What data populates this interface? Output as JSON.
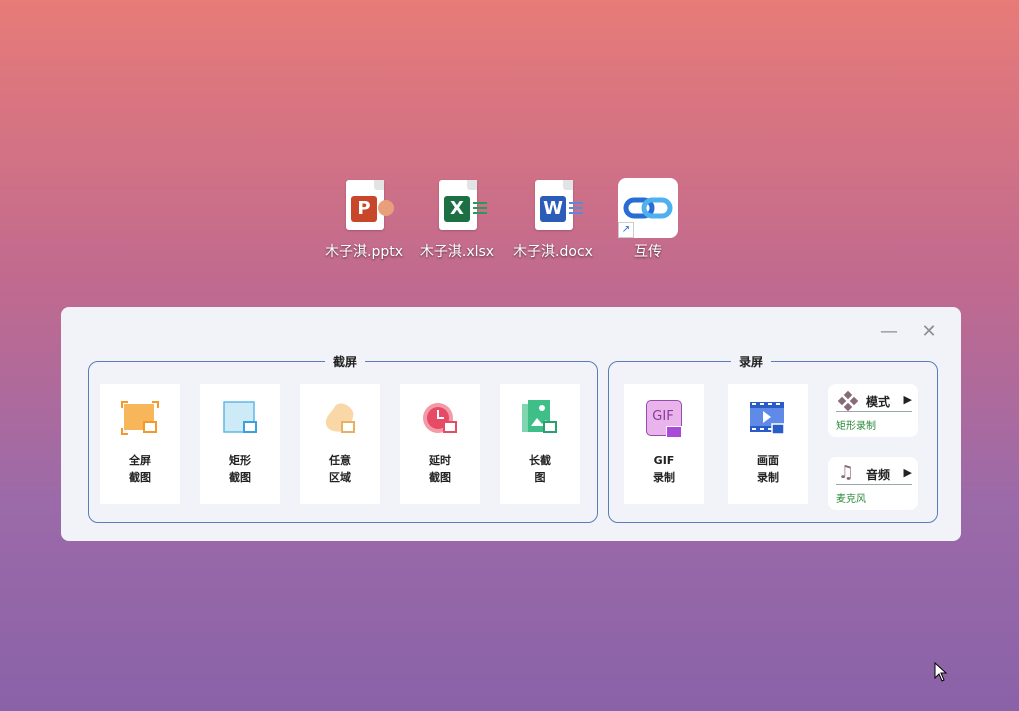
{
  "desktop": {
    "icons": [
      {
        "label": "木子淇.pptx",
        "badge": "P",
        "color": "#c8462a"
      },
      {
        "label": "木子淇.xlsx",
        "badge": "X",
        "color": "#1d7044"
      },
      {
        "label": "木子淇.docx",
        "badge": "W",
        "color": "#2b5cb8"
      },
      {
        "label": "互传"
      }
    ]
  },
  "panel": {
    "screenshot_group": {
      "title": "截屏",
      "tiles": [
        {
          "line1": "全屏",
          "line2": "截图"
        },
        {
          "line1": "矩形",
          "line2": "截图"
        },
        {
          "line1": "任意",
          "line2": "区域"
        },
        {
          "line1": "延时",
          "line2": "截图"
        },
        {
          "line1": "长截",
          "line2": "图"
        }
      ]
    },
    "record_group": {
      "title": "录屏",
      "tiles": [
        {
          "line1": "GIF",
          "line2": "录制",
          "icon_text": "GIF"
        },
        {
          "line1": "画面",
          "line2": "录制"
        }
      ],
      "mode": {
        "label": "模式",
        "value": "矩形录制"
      },
      "audio": {
        "label": "音频",
        "value": "麦克风"
      }
    }
  }
}
